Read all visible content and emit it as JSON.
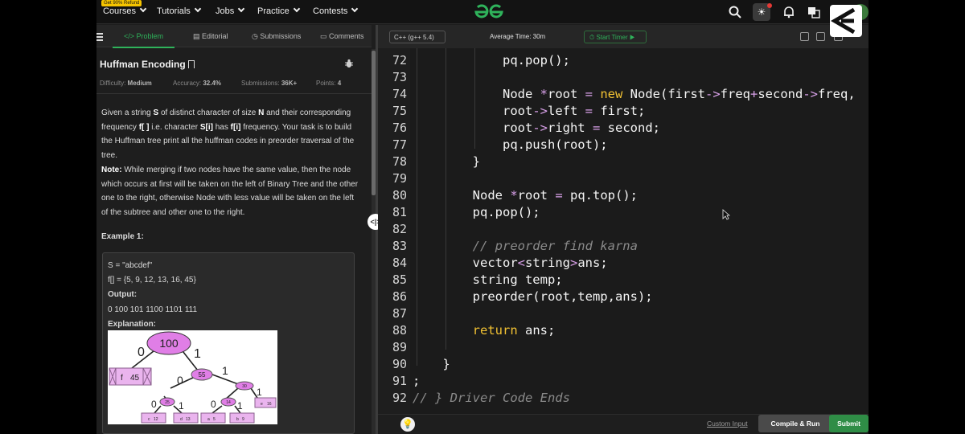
{
  "nav": {
    "promo": "Get 90% Refund",
    "items": [
      {
        "label": "Courses"
      },
      {
        "label": "Tutorials"
      },
      {
        "label": "Jobs"
      },
      {
        "label": "Practice"
      },
      {
        "label": "Contests"
      }
    ],
    "icons": [
      "search-icon",
      "theme-icon",
      "bell-icon",
      "translate-icon",
      "avatar"
    ]
  },
  "tabs": [
    {
      "label": "Problem",
      "icon": "code-icon",
      "active": true
    },
    {
      "label": "Editorial",
      "icon": "document-icon"
    },
    {
      "label": "Submissions",
      "icon": "clock-icon"
    },
    {
      "label": "Comments",
      "icon": "comment-icon"
    }
  ],
  "problem": {
    "title": "Huffman Encoding",
    "difficulty_label": "Difficulty:",
    "difficulty": "Medium",
    "accuracy_label": "Accuracy:",
    "accuracy": "32.4%",
    "submissions_label": "Submissions:",
    "submissions": "36K+",
    "points_label": "Points:",
    "points": "4",
    "desc": {
      "p1": "Given a string",
      "s": "S",
      "p2": "of distinct character of size",
      "n": "N",
      "p3": "and their corresponding frequency",
      "f": "f[ ]",
      "p4": "i.e. character",
      "si": "S[i]",
      "p5": "has",
      "fi": "f[i]",
      "p6": "frequency. Your task is to build the Huffman tree print all the huffman codes in preorder traversal of the tree.",
      "note_label": "Note:",
      "note": "While merging if two nodes have the same value, then the node which occurs at first will be taken on the left of Binary Tree and the other one to the right, otherwise Node with less value will be taken on the left of the subtree and other one to the right."
    },
    "example_heading": "Example 1:",
    "example": {
      "s_line": "S = \"abcdef\"",
      "f_line": "f[] = {5, 9, 12, 13, 16, 45}",
      "output_label": "Output:",
      "output": "0 100 101 1100 1101 111",
      "explanation_label": "Explanation:"
    },
    "tree": {
      "root": "100",
      "n55": "55",
      "n30": "30",
      "n25": "25",
      "n14": "14",
      "e0a": "0",
      "e1a": "1",
      "e0b": "0",
      "e1b": "1",
      "e0c": "0",
      "e1c": "1",
      "e0d": "0",
      "e1d": "1",
      "e1e": "1",
      "leaf_f": [
        "f",
        "45"
      ],
      "leaf_e": [
        "e",
        "16"
      ],
      "leaf_c": [
        "c",
        "12"
      ],
      "leaf_d": [
        "d",
        "13"
      ],
      "leaf_a": [
        "a",
        "5"
      ],
      "leaf_b": [
        "b",
        "9"
      ]
    }
  },
  "editor": {
    "language": "C++ (g++ 5.4)",
    "avg_time": "Average Time: 30m",
    "timer_label": "Start Timer",
    "lines": [
      {
        "n": "72",
        "html": "            pq.pop();"
      },
      {
        "n": "73",
        "html": ""
      },
      {
        "n": "74",
        "html": "            Node <span class=\"op\">*</span>root <span class=\"op\">=</span> <span class=\"kw\">new</span> Node(first<span class=\"op\">-></span>freq<span class=\"op\">+</span>second<span class=\"op\">-></span>freq,"
      },
      {
        "n": "75",
        "html": "            root<span class=\"op\">-></span>left <span class=\"op\">=</span> first;"
      },
      {
        "n": "76",
        "html": "            root<span class=\"op\">-></span>right <span class=\"op\">=</span> second;"
      },
      {
        "n": "77",
        "html": "            pq.push(root);"
      },
      {
        "n": "78",
        "html": "        }"
      },
      {
        "n": "79",
        "html": ""
      },
      {
        "n": "80",
        "html": "        Node <span class=\"op\">*</span>root <span class=\"op\">=</span> pq.top();"
      },
      {
        "n": "81",
        "html": "        pq.pop();"
      },
      {
        "n": "82",
        "html": ""
      },
      {
        "n": "83",
        "html": "        <span class=\"cm\">// preorder find karna</span>"
      },
      {
        "n": "84",
        "html": "        vector<span class=\"op\"><</span>string<span class=\"op\">></span>ans;"
      },
      {
        "n": "85",
        "html": "        string temp;"
      },
      {
        "n": "86",
        "html": "        preorder(root,temp,ans);"
      },
      {
        "n": "87",
        "html": ""
      },
      {
        "n": "88",
        "html": "        <span class=\"kw\">return</span> ans;"
      },
      {
        "n": "89",
        "html": ""
      },
      {
        "n": "90",
        "html": "    }"
      },
      {
        "n": "91",
        "html": ";"
      },
      {
        "n": "92",
        "html": "<span class=\"cm\">// } Driver Code Ends</span>"
      }
    ]
  },
  "footer": {
    "custom_input": "Custom Input",
    "compile": "Compile & Run",
    "submit": "Submit"
  },
  "colors": {
    "accent": "#2fb35b",
    "keyword": "#f2c233",
    "operator": "#d8a0e8",
    "node_fill": "#e07ee6"
  }
}
